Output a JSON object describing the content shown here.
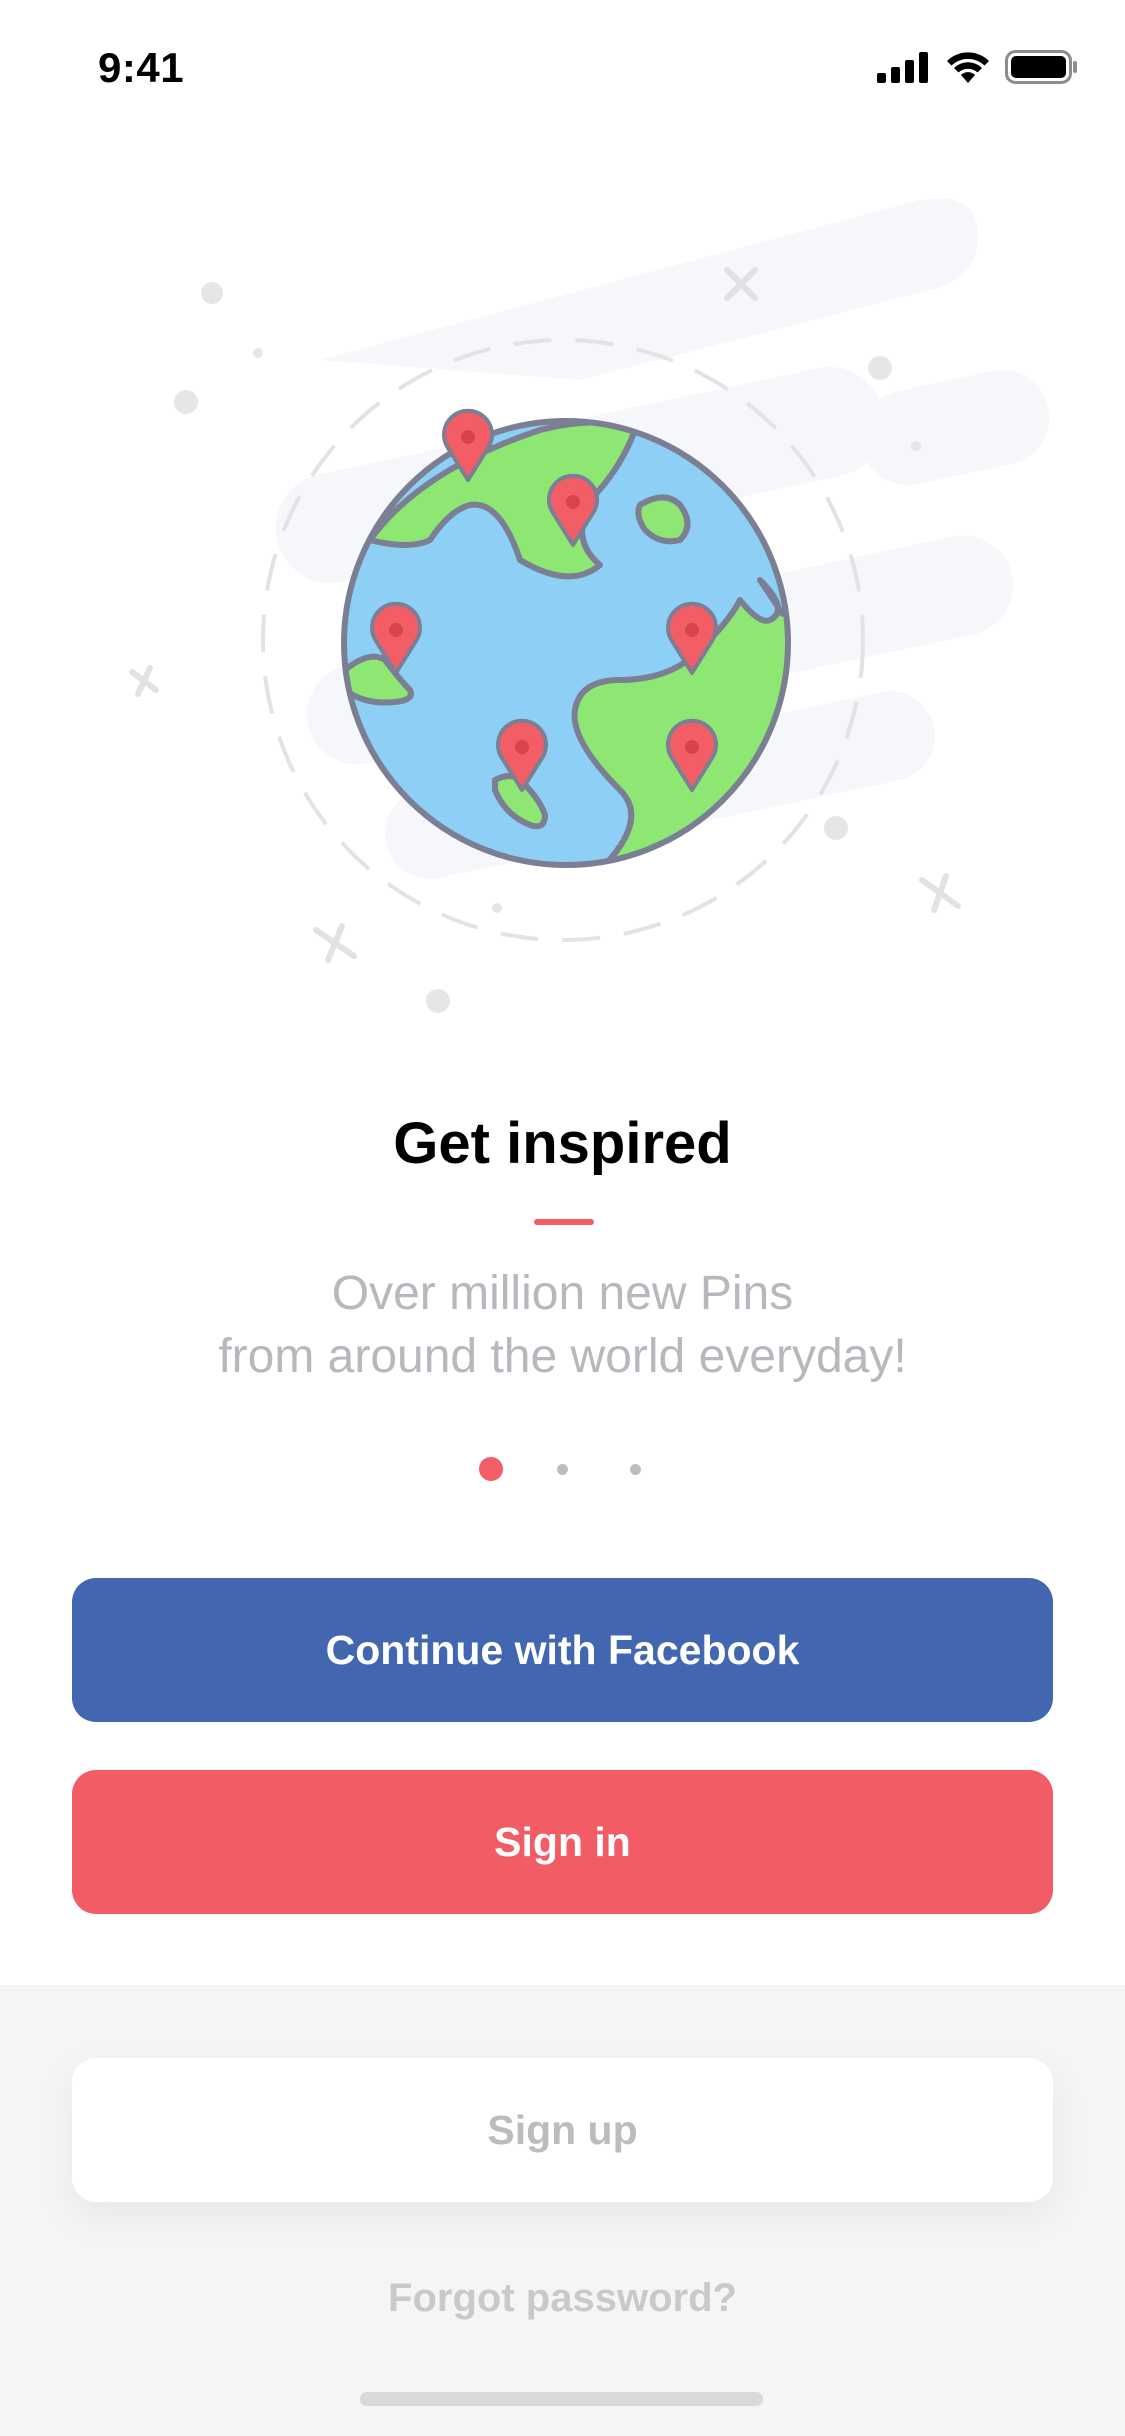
{
  "status_bar": {
    "time": "9:41",
    "icons": [
      "cellular-signal-icon",
      "wifi-icon",
      "battery-icon"
    ]
  },
  "illustration": {
    "icon": "globe-with-map-pins-icon",
    "colors": {
      "ocean": "#8dcff5",
      "land": "#8ee673",
      "pin": "#f25d66",
      "outline": "#7b7f93"
    }
  },
  "onboarding": {
    "title": "Get inspired",
    "subtitle_line1": "Over million new Pins",
    "subtitle_line2": "from around the world everyday!",
    "page_indicator": {
      "current": 1,
      "total": 3
    }
  },
  "actions": {
    "facebook_label": "Continue with Facebook",
    "signin_label": "Sign in",
    "signup_label": "Sign up",
    "forgot_label": "Forgot password?"
  },
  "colors": {
    "facebook": "#4266b0",
    "accent": "#f25c65",
    "muted_text": "#b7b8bd"
  }
}
